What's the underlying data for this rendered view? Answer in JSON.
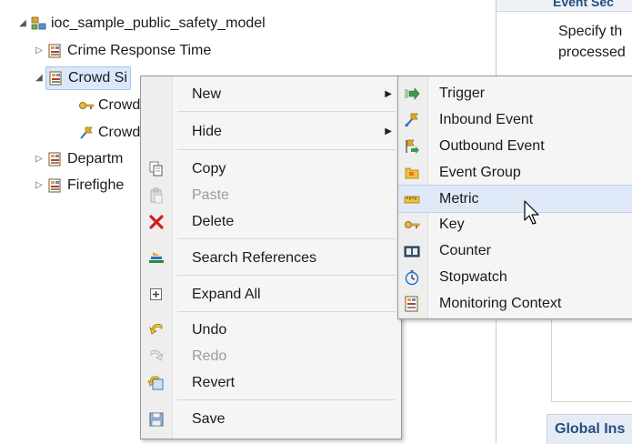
{
  "tree": {
    "root_label": "ioc_sample_public_safety_model",
    "items": [
      {
        "label": "Crime Response Time"
      },
      {
        "label": "Crowd Si"
      },
      {
        "label": "Crowd"
      },
      {
        "label": "Crowd"
      },
      {
        "label": "Departm"
      },
      {
        "label": "Firefighe"
      }
    ]
  },
  "right_panel": {
    "header": "Event Sec",
    "line1": "Specify th",
    "line2": "processed",
    "bottom_header": "Global Ins"
  },
  "context_menu": {
    "new": "New",
    "hide": "Hide",
    "copy": "Copy",
    "paste": "Paste",
    "delete": "Delete",
    "search_references": "Search References",
    "expand_all": "Expand All",
    "undo": "Undo",
    "redo": "Redo",
    "revert": "Revert",
    "save": "Save"
  },
  "submenu": {
    "trigger": "Trigger",
    "inbound_event": "Inbound Event",
    "outbound_event": "Outbound Event",
    "event_group": "Event Group",
    "metric": "Metric",
    "key": "Key",
    "counter": "Counter",
    "stopwatch": "Stopwatch",
    "monitoring_context": "Monitoring Context"
  },
  "icons": {
    "project": "project-icon",
    "context": "monitoring-context-icon",
    "key": "key-icon",
    "event": "event-icon",
    "copy": "copy-icon",
    "paste": "paste-icon",
    "delete": "delete-x-icon",
    "search": "search-references-icon",
    "expand": "expand-all-icon",
    "undo": "undo-icon",
    "redo": "redo-icon",
    "revert": "revert-icon",
    "save": "save-icon"
  },
  "colors": {
    "selection": "#dbe8fb",
    "hover": "#dfe9f7",
    "menu_bg": "#f5f5f5",
    "panel_title": "#274d80",
    "delete_red": "#d11e1e"
  }
}
